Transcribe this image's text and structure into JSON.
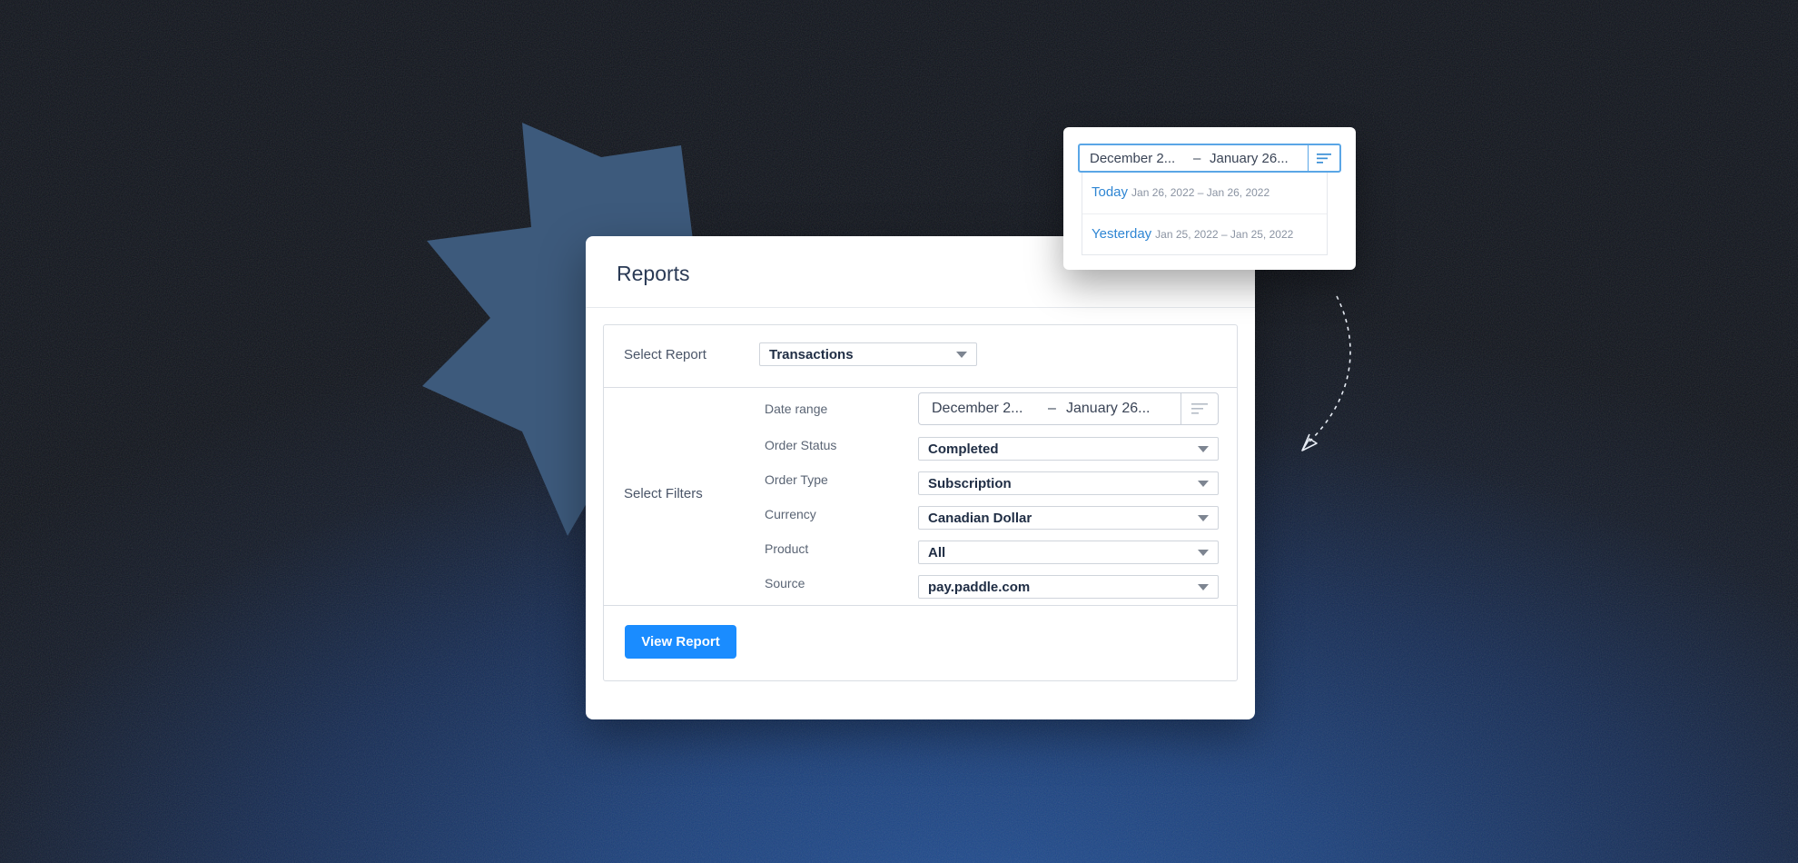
{
  "colors": {
    "accent": "#1a8cff",
    "link": "#2f86d3",
    "title_text": "#2a3a55",
    "star": "#3d5a7c"
  },
  "card": {
    "title": "Reports",
    "select_report": {
      "label": "Select Report",
      "value": "Transactions"
    },
    "filters": {
      "label": "Select Filters",
      "date_range": {
        "label": "Date range",
        "start": "December 2...",
        "separator": "–",
        "end": "January 26..."
      },
      "order_status": {
        "label": "Order Status",
        "value": "Completed"
      },
      "order_type": {
        "label": "Order Type",
        "value": "Subscription"
      },
      "currency": {
        "label": "Currency",
        "value": "Canadian Dollar"
      },
      "product": {
        "label": "Product",
        "value": "All"
      },
      "source": {
        "label": "Source",
        "value": "pay.paddle.com"
      }
    },
    "view_button": "View Report"
  },
  "popup": {
    "date_range": {
      "start": "December 2...",
      "separator": "–",
      "end": "January 26..."
    },
    "options": [
      {
        "name": "Today",
        "range": "Jan 26, 2022 – Jan 26, 2022"
      },
      {
        "name": "Yesterday",
        "range": "Jan 25, 2022 – Jan 25, 2022"
      }
    ]
  },
  "icons": {
    "filter_lines": "filter-lines-icon",
    "caret": "chevron-down-icon",
    "arrow": "dashed-curved-arrow-icon"
  }
}
